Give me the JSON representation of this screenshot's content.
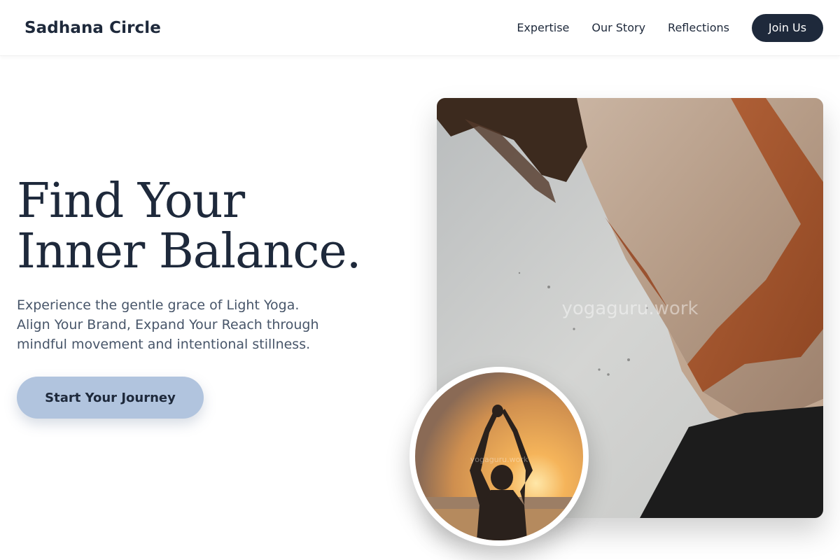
{
  "header": {
    "logo": "Sadhana Circle",
    "nav": [
      {
        "label": "Expertise"
      },
      {
        "label": "Our Story"
      },
      {
        "label": "Reflections"
      }
    ],
    "cta_label": "Join Us"
  },
  "hero": {
    "title": "Find Your Inner Balance.",
    "subtitle": "Experience the gentle grace of Light Yoga. Align Your Brand, Expand Your Reach through mindful movement and intentional stillness.",
    "cta_label": "Start Your Journey"
  },
  "images": {
    "main_watermark": "yogaguru.work",
    "circle_watermark": "yogaguru.work"
  },
  "colors": {
    "primary": "#1e293b",
    "accent": "#b1c4de",
    "muted_text": "#475569"
  }
}
